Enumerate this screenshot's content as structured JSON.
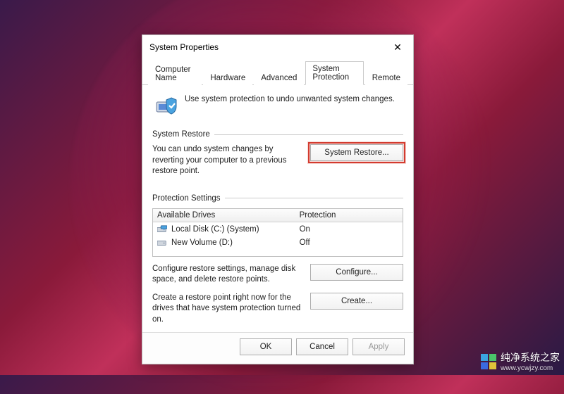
{
  "window": {
    "title": "System Properties",
    "tabs": [
      "Computer Name",
      "Hardware",
      "Advanced",
      "System Protection",
      "Remote"
    ],
    "active_tab_index": 3
  },
  "intro": {
    "text": "Use system protection to undo unwanted system changes."
  },
  "system_restore": {
    "group_title": "System Restore",
    "desc": "You can undo system changes by reverting your computer to a previous restore point.",
    "button": "System Restore..."
  },
  "protection_settings": {
    "group_title": "Protection Settings",
    "col_drive": "Available Drives",
    "col_prot": "Protection",
    "rows": [
      {
        "name": "Local Disk (C:) (System)",
        "protection": "On",
        "icon": "drive-system"
      },
      {
        "name": "New Volume (D:)",
        "protection": "Off",
        "icon": "drive"
      }
    ],
    "configure_desc": "Configure restore settings, manage disk space, and delete restore points.",
    "configure_button": "Configure...",
    "create_desc": "Create a restore point right now for the drives that have system protection turned on.",
    "create_button": "Create..."
  },
  "footer": {
    "ok": "OK",
    "cancel": "Cancel",
    "apply": "Apply"
  },
  "watermark": {
    "line1": "纯净系统之家",
    "line2": "www.ycwjzy.com"
  }
}
